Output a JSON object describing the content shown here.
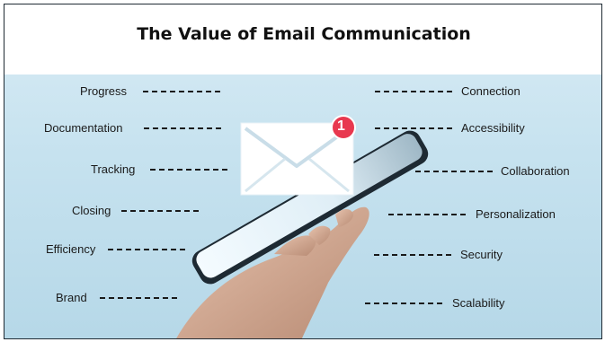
{
  "title": "The Value of Email Communication",
  "left_items": [
    "Progress",
    "Documentation",
    "Tracking",
    "Closing",
    "Efficiency",
    "Brand"
  ],
  "right_items": [
    "Connection",
    "Accessibility",
    "Collaboration",
    "Personalization",
    "Security",
    "Scalability"
  ],
  "notification_count": "1",
  "colors": {
    "background": "#c6e2ef",
    "badge": "#e8384f",
    "text": "#1a1a1a"
  }
}
